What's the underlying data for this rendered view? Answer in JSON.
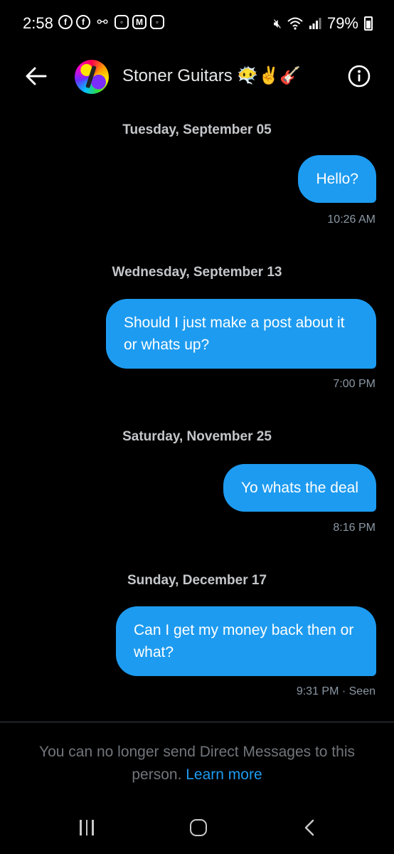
{
  "status_bar": {
    "time": "2:58",
    "left_icons": [
      "facebook-icon",
      "facebook-icon",
      "voicemail-icon",
      "instagram-icon",
      "gmail-icon",
      "instagram-icon"
    ],
    "battery": "79%"
  },
  "header": {
    "title": "Stoner Guitars 😶‍🌫️✌️🎸"
  },
  "messages": [
    {
      "date": "Tuesday, September 05",
      "text": "Hello?",
      "meta": "10:26 AM"
    },
    {
      "date": "Wednesday, September 13",
      "text": "Should I just make a post about it or whats up?",
      "meta": "7:00 PM"
    },
    {
      "date": "Saturday, November 25",
      "text": "Yo whats the deal",
      "meta": "8:16 PM"
    },
    {
      "date": "Sunday, December 17",
      "text": "Can I get my money back then or what?",
      "meta": "9:31 PM · Seen"
    }
  ],
  "footer": {
    "notice": "You can no longer send Direct Messages to this person.",
    "learn_more": "Learn more"
  },
  "colors": {
    "accent": "#1d9bf0",
    "background": "#000000",
    "muted_text": "#71767b"
  }
}
